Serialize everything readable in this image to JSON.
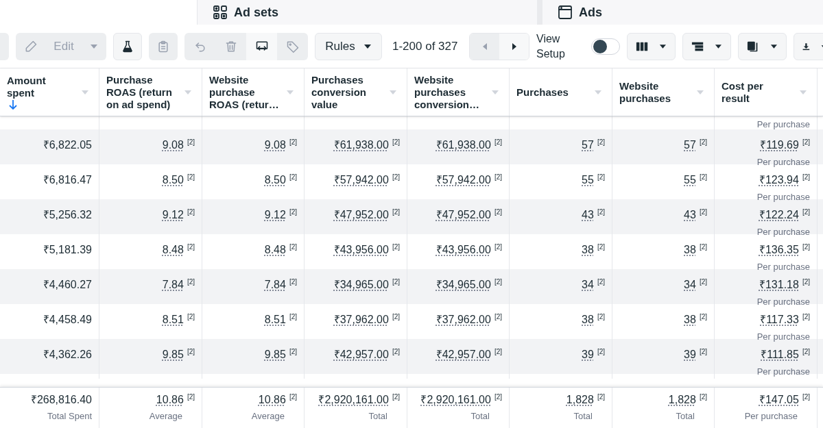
{
  "tabs": [
    {
      "label": "Ad sets"
    },
    {
      "label": "Ads"
    }
  ],
  "toolbar": {
    "edit_button": {
      "label": "Edit",
      "disabled": true
    },
    "icon_buttons": [
      {
        "disabled": false
      },
      {
        "disabled": true
      }
    ],
    "action_buttons": [
      {
        "disabled": true
      },
      {
        "disabled": true
      },
      {
        "disabled": false
      },
      {
        "disabled": true
      }
    ],
    "rules_button": {
      "label": "Rules"
    },
    "page_range": "1-200 of 327",
    "pager": [
      {
        "disabled": true
      },
      {
        "disabled": false
      }
    ],
    "view_setup": {
      "label": "View Setup",
      "on": false
    }
  },
  "table": {
    "columns": [
      {
        "label": "Amount spent",
        "sorted": true
      },
      {
        "label": "Purchase ROAS (return on ad spend)",
        "sorted": false
      },
      {
        "label": "Website purchase ROAS (retur…",
        "sorted": false
      },
      {
        "label": "Purchases conversion value",
        "sorted": false
      },
      {
        "label": "Website purchases conversion…",
        "sorted": false
      },
      {
        "label": "Purchases",
        "sorted": false
      },
      {
        "label": "Website purchases",
        "sorted": false
      },
      {
        "label": "Cost per result",
        "sorted": false
      }
    ],
    "rows": [
      {
        "sub": "Per purchase"
      },
      {
        "cells": [
          {
            "value": "₹6,822.05"
          },
          {
            "value": "9.08",
            "note": "[2]"
          },
          {
            "value": "9.08",
            "note": "[2]"
          },
          {
            "value": "₹61,938.00",
            "note": "[2]"
          },
          {
            "value": "₹61,938.00",
            "note": "[2]"
          },
          {
            "value": "57",
            "note": "[2]"
          },
          {
            "value": "57",
            "note": "[2]"
          },
          {
            "value": "₹119.69",
            "note": "[2]"
          }
        ],
        "sub": "Per purchase"
      },
      {
        "cells": [
          {
            "value": "₹6,816.47"
          },
          {
            "value": "8.50",
            "note": "[2]"
          },
          {
            "value": "8.50",
            "note": "[2]"
          },
          {
            "value": "₹57,942.00",
            "note": "[2]"
          },
          {
            "value": "₹57,942.00",
            "note": "[2]"
          },
          {
            "value": "55",
            "note": "[2]"
          },
          {
            "value": "55",
            "note": "[2]"
          },
          {
            "value": "₹123.94",
            "note": "[2]"
          }
        ],
        "sub": "Per purchase"
      },
      {
        "cells": [
          {
            "value": "₹5,256.32"
          },
          {
            "value": "9.12",
            "note": "[2]"
          },
          {
            "value": "9.12",
            "note": "[2]"
          },
          {
            "value": "₹47,952.00",
            "note": "[2]"
          },
          {
            "value": "₹47,952.00",
            "note": "[2]"
          },
          {
            "value": "43",
            "note": "[2]"
          },
          {
            "value": "43",
            "note": "[2]"
          },
          {
            "value": "₹122.24",
            "note": "[2]"
          }
        ],
        "sub": "Per purchase"
      },
      {
        "cells": [
          {
            "value": "₹5,181.39"
          },
          {
            "value": "8.48",
            "note": "[2]"
          },
          {
            "value": "8.48",
            "note": "[2]"
          },
          {
            "value": "₹43,956.00",
            "note": "[2]"
          },
          {
            "value": "₹43,956.00",
            "note": "[2]"
          },
          {
            "value": "38",
            "note": "[2]"
          },
          {
            "value": "38",
            "note": "[2]"
          },
          {
            "value": "₹136.35",
            "note": "[2]"
          }
        ],
        "sub": "Per purchase"
      },
      {
        "cells": [
          {
            "value": "₹4,460.27"
          },
          {
            "value": "7.84",
            "note": "[2]"
          },
          {
            "value": "7.84",
            "note": "[2]"
          },
          {
            "value": "₹34,965.00",
            "note": "[2]"
          },
          {
            "value": "₹34,965.00",
            "note": "[2]"
          },
          {
            "value": "34",
            "note": "[2]"
          },
          {
            "value": "34",
            "note": "[2]"
          },
          {
            "value": "₹131.18",
            "note": "[2]"
          }
        ],
        "sub": "Per purchase"
      },
      {
        "cells": [
          {
            "value": "₹4,458.49"
          },
          {
            "value": "8.51",
            "note": "[2]"
          },
          {
            "value": "8.51",
            "note": "[2]"
          },
          {
            "value": "₹37,962.00",
            "note": "[2]"
          },
          {
            "value": "₹37,962.00",
            "note": "[2]"
          },
          {
            "value": "38",
            "note": "[2]"
          },
          {
            "value": "38",
            "note": "[2]"
          },
          {
            "value": "₹117.33",
            "note": "[2]"
          }
        ],
        "sub": "Per purchase"
      },
      {
        "cells": [
          {
            "value": "₹4,362.26"
          },
          {
            "value": "9.85",
            "note": "[2]"
          },
          {
            "value": "9.85",
            "note": "[2]"
          },
          {
            "value": "₹42,957.00",
            "note": "[2]"
          },
          {
            "value": "₹42,957.00",
            "note": "[2]"
          },
          {
            "value": "39",
            "note": "[2]"
          },
          {
            "value": "39",
            "note": "[2]"
          },
          {
            "value": "₹111.85",
            "note": "[2]"
          }
        ],
        "sub": "Per purchase"
      }
    ],
    "totals": [
      {
        "value": "₹268,816.40",
        "sub": "Total Spent"
      },
      {
        "value": "10.86",
        "note": "[2]",
        "sub": "Average"
      },
      {
        "value": "10.86",
        "note": "[2]",
        "sub": "Average"
      },
      {
        "value": "₹2,920,161.00",
        "note": "[2]",
        "sub": "Total"
      },
      {
        "value": "₹2,920,161.00",
        "note": "[2]",
        "sub": "Total"
      },
      {
        "value": "1,828",
        "note": "[2]",
        "sub": "Total"
      },
      {
        "value": "1,828",
        "note": "[2]",
        "sub": "Total"
      },
      {
        "value": "₹147.05",
        "note": "[2]",
        "sub": "Per purchase"
      }
    ]
  }
}
